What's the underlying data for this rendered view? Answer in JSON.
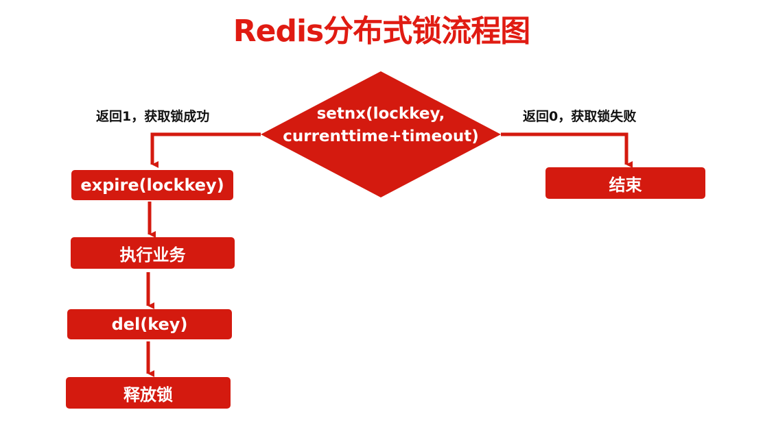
{
  "title": "Redis分布式锁流程图",
  "colors": {
    "title": "#e01b12",
    "shape": "#d41a0f",
    "shape_text": "#ffffff",
    "label_text": "#111111",
    "background": "#ffffff"
  },
  "decision": {
    "line1": "setnx(lockkey,",
    "line2": "currenttime+timeout)"
  },
  "branches": {
    "success": "返回1，获取锁成功",
    "failure": "返回0，获取锁失败"
  },
  "steps": {
    "expire": "expire(lockkey)",
    "execute": "执行业务",
    "delete": "del(key)",
    "release": "释放锁"
  },
  "end": "结束"
}
